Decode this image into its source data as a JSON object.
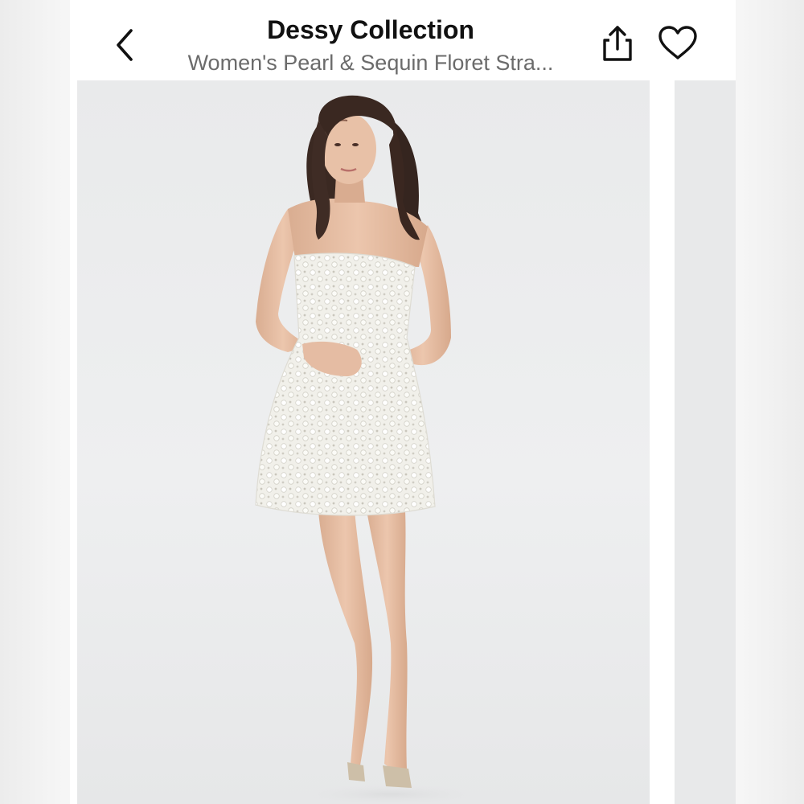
{
  "header": {
    "title": "Dessy Collection",
    "subtitle": "Women's Pearl & Sequin Floret Stra..."
  },
  "icons": {
    "back": "chevron-left-icon",
    "share": "share-icon",
    "like": "heart-icon"
  },
  "gallery": {
    "main_image": "model-photo",
    "next_image": "next-photo-peek"
  },
  "colors": {
    "title": "#111111",
    "subtitle": "#6b6b6b",
    "photo_background": "#eeeff0"
  }
}
